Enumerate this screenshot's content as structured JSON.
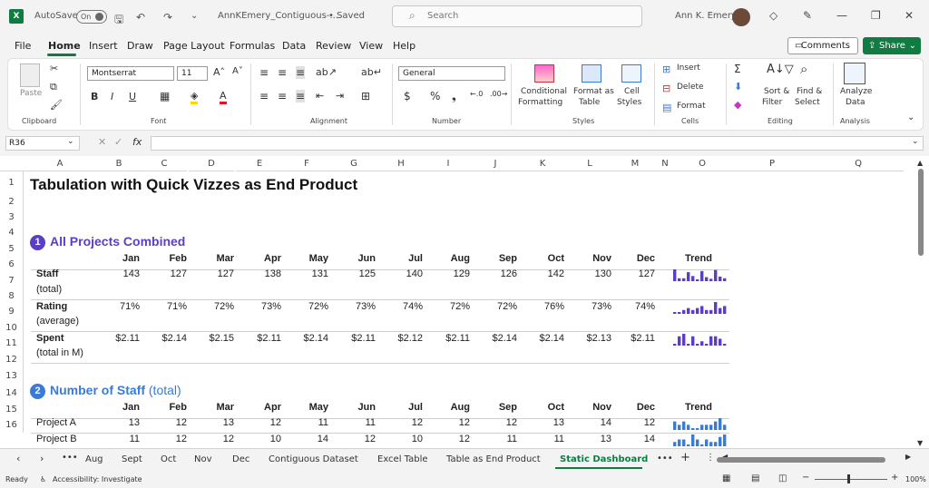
{
  "title_bar": {
    "autosave": "AutoSave",
    "autosave_state": "On",
    "filename": "AnnKEmery_Contiguous-...",
    "saved": "• Saved",
    "search_placeholder": "Search",
    "user": "Ann K. Emery"
  },
  "menu": [
    "File",
    "Home",
    "Insert",
    "Draw",
    "Page Layout",
    "Formulas",
    "Data",
    "Review",
    "View",
    "Help"
  ],
  "menu_active": "Home",
  "comments_label": "Comments",
  "share_label": "Share",
  "ribbon": {
    "clipboard": {
      "paste": "Paste",
      "group": "Clipboard"
    },
    "font": {
      "name": "Montserrat",
      "size": "11",
      "bold": "B",
      "italic": "I",
      "underline": "U",
      "group": "Font"
    },
    "alignment": {
      "group": "Alignment"
    },
    "number": {
      "format": "General",
      "group": "Number"
    },
    "styles": {
      "cond_line1": "Conditional",
      "cond_line2": "Formatting",
      "table_line1": "Format as",
      "table_line2": "Table",
      "cell_line1": "Cell",
      "cell_line2": "Styles",
      "group": "Styles"
    },
    "cells": {
      "insert": "Insert",
      "delete": "Delete",
      "format": "Format",
      "group": "Cells"
    },
    "editing": {
      "sort_line1": "Sort &",
      "sort_line2": "Filter",
      "find_line1": "Find &",
      "find_line2": "Select",
      "group": "Editing"
    },
    "analysis": {
      "analyze_line1": "Analyze",
      "analyze_line2": "Data",
      "group": "Analysis"
    }
  },
  "name_box": "R36",
  "fx": "fx",
  "columns": [
    "A",
    "B",
    "C",
    "D",
    "E",
    "F",
    "G",
    "H",
    "I",
    "J",
    "K",
    "L",
    "M",
    "N",
    "O",
    "P",
    "Q"
  ],
  "rows": [
    "1",
    "2",
    "3",
    "4",
    "5",
    "6",
    "7",
    "8",
    "9",
    "10",
    "11",
    "12",
    "13",
    "14",
    "15",
    "16"
  ],
  "sheet": {
    "title": "Tabulation with Quick Vizzes as End Product",
    "section1": {
      "number": "1",
      "title": "All Projects Combined"
    },
    "section2": {
      "number": "2",
      "title": "Number of Staff",
      "suffix": "(total)"
    },
    "months": [
      "Jan",
      "Feb",
      "Mar",
      "Apr",
      "May",
      "Jun",
      "Jul",
      "Aug",
      "Sep",
      "Oct",
      "Nov",
      "Dec"
    ],
    "trend_label": "Trend",
    "staff": {
      "label": "Staff",
      "sub": "(total)",
      "values": [
        "143",
        "127",
        "127",
        "138",
        "131",
        "125",
        "140",
        "129",
        "126",
        "142",
        "130",
        "127"
      ],
      "raw": [
        143,
        127,
        127,
        138,
        131,
        125,
        140,
        129,
        126,
        142,
        130,
        127
      ]
    },
    "rating": {
      "label": "Rating",
      "sub": "(average)",
      "values": [
        "71%",
        "71%",
        "72%",
        "73%",
        "72%",
        "73%",
        "74%",
        "72%",
        "72%",
        "76%",
        "73%",
        "74%"
      ],
      "raw": [
        71,
        71,
        72,
        73,
        72,
        73,
        74,
        72,
        72,
        76,
        73,
        74
      ]
    },
    "spent": {
      "label": "Spent",
      "sub": "(total in M)",
      "values": [
        "$2.11",
        "$2.14",
        "$2.15",
        "$2.11",
        "$2.14",
        "$2.11",
        "$2.12",
        "$2.11",
        "$2.14",
        "$2.14",
        "$2.13",
        "$2.11"
      ],
      "raw": [
        2.11,
        2.14,
        2.15,
        2.11,
        2.14,
        2.11,
        2.12,
        2.11,
        2.14,
        2.14,
        2.13,
        2.11
      ]
    },
    "project_a": {
      "label": "Project A",
      "values": [
        "13",
        "12",
        "13",
        "12",
        "11",
        "11",
        "12",
        "12",
        "12",
        "13",
        "14",
        "12"
      ],
      "raw": [
        13,
        12,
        13,
        12,
        11,
        11,
        12,
        12,
        12,
        13,
        14,
        12
      ]
    },
    "project_b": {
      "label": "Project B",
      "values": [
        "11",
        "12",
        "12",
        "10",
        "14",
        "12",
        "10",
        "12",
        "11",
        "11",
        "13",
        "14"
      ],
      "raw": [
        11,
        12,
        12,
        10,
        14,
        12,
        10,
        12,
        11,
        11,
        13,
        14
      ]
    }
  },
  "sheet_tabs": [
    "Aug",
    "Sept",
    "Oct",
    "Nov",
    "Dec",
    "Contiguous Dataset",
    "Excel Table",
    "Table as End Product",
    "Static Dashboard"
  ],
  "active_tab": "Static Dashboard",
  "status": {
    "ready": "Ready",
    "accessibility": "Accessibility: Investigate",
    "zoom": "100%"
  },
  "colors": {
    "excel_green": "#107c41",
    "purple": "#5b3dc8",
    "blue": "#3a7bd5"
  }
}
